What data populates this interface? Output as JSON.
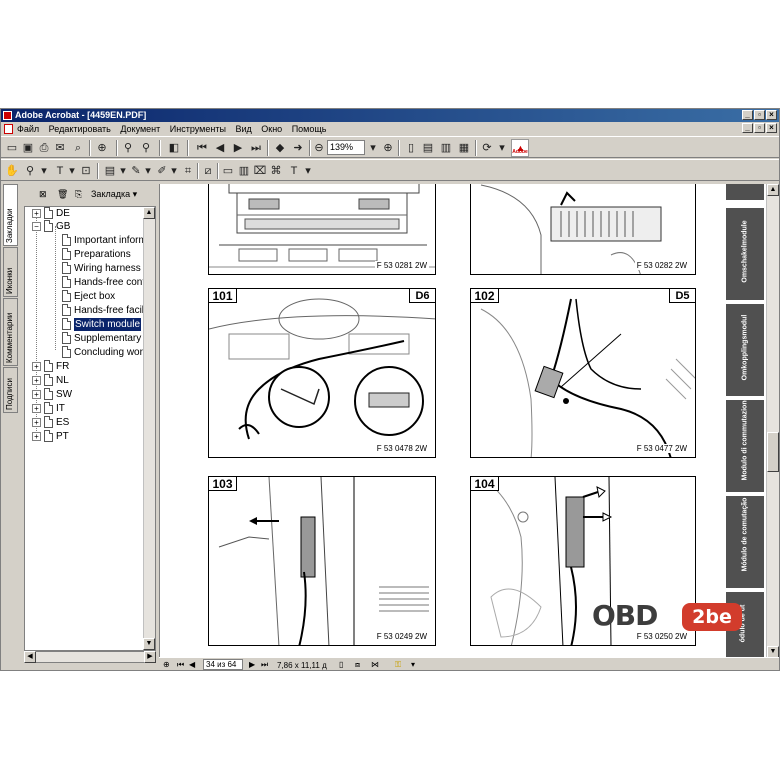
{
  "window": {
    "title": "Adobe Acrobat - [4459EN.PDF]"
  },
  "menu": {
    "items": [
      "Файл",
      "Редактировать",
      "Документ",
      "Инструменты",
      "Вид",
      "Окно",
      "Помощь"
    ]
  },
  "toolbar": {
    "zoom": "139%",
    "adobe_label": "Adobe"
  },
  "panel": {
    "tabs": [
      "Закладки",
      "Иконки",
      "Комментарии",
      "Подписи"
    ],
    "header_label": "Закладка ▾",
    "bookmarks": [
      {
        "label": "DE",
        "expand": "+"
      },
      {
        "label": "GB",
        "expand": "−"
      },
      {
        "label": "Important informa"
      },
      {
        "label": "Preparations"
      },
      {
        "label": "Wiring harness"
      },
      {
        "label": "Hands-free contr"
      },
      {
        "label": "Eject box"
      },
      {
        "label": "Hands-free facilit"
      },
      {
        "label": "Switch module"
      },
      {
        "label": "Supplementary c"
      },
      {
        "label": "Concluding work"
      },
      {
        "label": "FR",
        "expand": "+"
      },
      {
        "label": "NL",
        "expand": "+"
      },
      {
        "label": "SW",
        "expand": "+"
      },
      {
        "label": "IT",
        "expand": "+"
      },
      {
        "label": "ES",
        "expand": "+"
      },
      {
        "label": "PT",
        "expand": "+"
      }
    ],
    "selected": "Switch module"
  },
  "figures": {
    "top_left_ref": "F 53 0281 2W",
    "top_right_ref": "F 53 0282 2W",
    "f101": {
      "num": "101",
      "code": "D6",
      "ref": "F 53 0478 2W"
    },
    "f102": {
      "num": "102",
      "code": "D5",
      "ref": "F 53 0477 2W"
    },
    "f103": {
      "num": "103",
      "ref": "F 53 0249 2W"
    },
    "f104": {
      "num": "104",
      "ref": "F 53 0250 2W"
    }
  },
  "side_tabs": [
    "Omschakelmodule",
    "Omkopplingsmodul",
    "Modulo di commutazione",
    "Módulo de comutação",
    "ódulo de ut"
  ],
  "status": {
    "page": "34 из 64",
    "size": "7,86 x 11,11 д"
  },
  "watermark": {
    "left": "OBD",
    "right": "2be"
  },
  "colors": {
    "title_bar": "#0a246a",
    "selection": "#0a246a",
    "side_tab": "#505050",
    "watermark_red": "#d23c2c"
  }
}
